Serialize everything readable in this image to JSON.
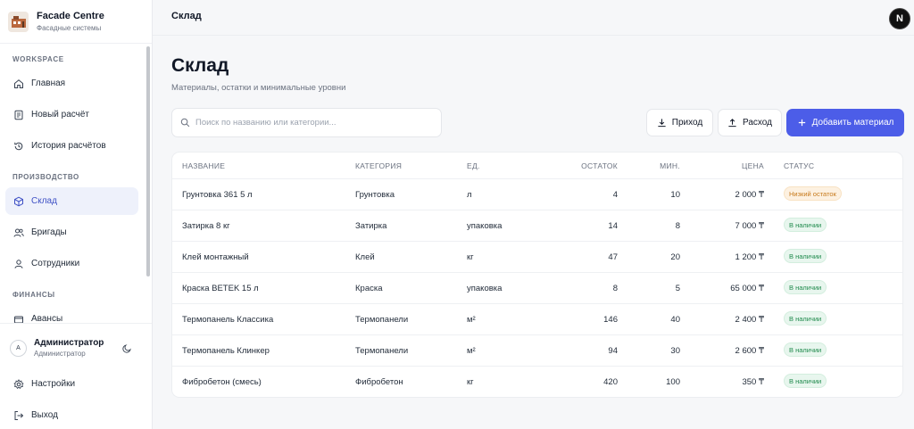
{
  "brand": {
    "title": "Facade Centre",
    "subtitle": "Фасадные системы"
  },
  "sidebar": {
    "sections": [
      {
        "title": "WORKSPACE"
      },
      {
        "title": "ПРОИЗВОДСТВО"
      },
      {
        "title": "ФИНАНСЫ"
      }
    ],
    "items": [
      {
        "label": "Главная",
        "icon": "home-icon"
      },
      {
        "label": "Новый расчёт",
        "icon": "document-icon"
      },
      {
        "label": "История расчётов",
        "icon": "history-icon"
      },
      {
        "label": "Склад",
        "icon": "box-icon",
        "active": true
      },
      {
        "label": "Бригады",
        "icon": "users-icon"
      },
      {
        "label": "Сотрудники",
        "icon": "user-icon"
      },
      {
        "label": "Авансы",
        "icon": "wallet-icon"
      }
    ],
    "user": {
      "initial": "А",
      "name": "Администратор",
      "role": "Администратор"
    },
    "footer": [
      {
        "label": "Настройки",
        "icon": "gear-icon"
      },
      {
        "label": "Выход",
        "icon": "logout-icon"
      }
    ]
  },
  "topbar": {
    "breadcrumb": "Склад",
    "avatar_letter": "N"
  },
  "page": {
    "title": "Склад",
    "subtitle": "Материалы, остатки и минимальные уровни",
    "search_placeholder": "Поиск по названию или категории...",
    "buttons": {
      "income": "Приход",
      "expense": "Расход",
      "add": "Добавить материал"
    }
  },
  "table": {
    "headers": [
      "НАЗВАНИЕ",
      "КАТЕГОРИЯ",
      "ЕД.",
      "ОСТАТОК",
      "МИН.",
      "ЦЕНА",
      "СТАТУС"
    ],
    "rows": [
      {
        "name": "Грунтовка 361 5 л",
        "category": "Грунтовка",
        "unit": "л",
        "stock": "4",
        "min": "10",
        "price": "2 000 ₸",
        "status": "Низкий остаток",
        "status_type": "low"
      },
      {
        "name": "Затирка 8 кг",
        "category": "Затирка",
        "unit": "упаковка",
        "stock": "14",
        "min": "8",
        "price": "7 000 ₸",
        "status": "В наличии",
        "status_type": "ok"
      },
      {
        "name": "Клей монтажный",
        "category": "Клей",
        "unit": "кг",
        "stock": "47",
        "min": "20",
        "price": "1 200 ₸",
        "status": "В наличии",
        "status_type": "ok"
      },
      {
        "name": "Краска BETEK 15 л",
        "category": "Краска",
        "unit": "упаковка",
        "stock": "8",
        "min": "5",
        "price": "65 000 ₸",
        "status": "В наличии",
        "status_type": "ok"
      },
      {
        "name": "Термопанель Классика",
        "category": "Термопанели",
        "unit": "м²",
        "stock": "146",
        "min": "40",
        "price": "2 400 ₸",
        "status": "В наличии",
        "status_type": "ok"
      },
      {
        "name": "Термопанель Клинкер",
        "category": "Термопанели",
        "unit": "м²",
        "stock": "94",
        "min": "30",
        "price": "2 600 ₸",
        "status": "В наличии",
        "status_type": "ok"
      },
      {
        "name": "Фибробетон (смесь)",
        "category": "Фибробетон",
        "unit": "кг",
        "stock": "420",
        "min": "100",
        "price": "350 ₸",
        "status": "В наличии",
        "status_type": "ok"
      }
    ]
  }
}
